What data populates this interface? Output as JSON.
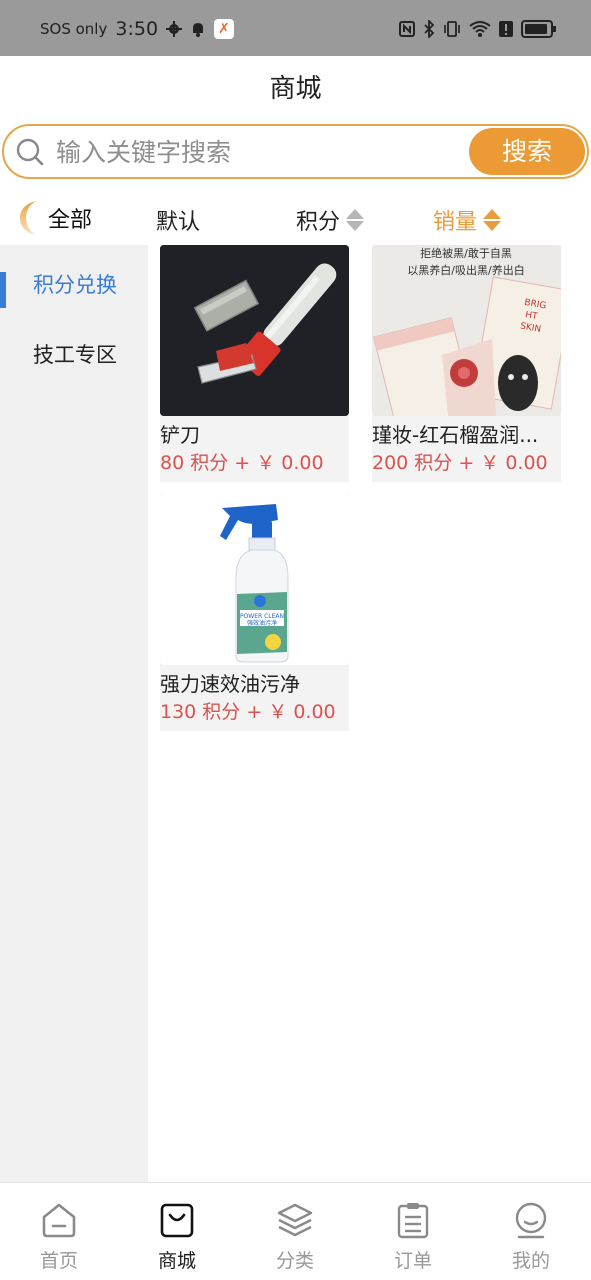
{
  "status_bar": {
    "carrier": "SOS only",
    "time": "3:50",
    "icons": [
      "gear-icon",
      "bell-icon",
      "app-badge-icon",
      "nfc-icon",
      "bluetooth-icon",
      "vibrate-icon",
      "wifi-icon",
      "alert-icon",
      "battery-icon"
    ]
  },
  "header": {
    "title": "商城"
  },
  "search": {
    "placeholder": "输入关键字搜索",
    "button_label": "搜索"
  },
  "sort": {
    "all_label": "全部",
    "default_label": "默认",
    "points_label": "积分",
    "sales_label": "销量",
    "active": "sales",
    "accent_color": "#e99c3c"
  },
  "sidebar": {
    "items": [
      {
        "label": "积分兑换",
        "active": true
      },
      {
        "label": "技工专区",
        "active": false
      }
    ],
    "active_color": "#3a7bd5"
  },
  "products": [
    {
      "name": "铲刀",
      "price": "80 积分 + ￥ 0.00",
      "image": "scraper"
    },
    {
      "name": "瑾妆-红石榴盈润...",
      "price": "200 积分 + ￥ 0.00",
      "image": "face-mask",
      "image_text": [
        "拒绝被黑/敢于自黑",
        "以黑养白/吸出黑/养出白",
        "BRIG",
        "HT",
        "SKIN"
      ]
    },
    {
      "name": "强力速效油污净",
      "price": "130 积分 + ￥ 0.00",
      "image": "spray-bottle",
      "image_text": [
        "POWER CLEAN",
        "强效油污净"
      ]
    }
  ],
  "bottom_nav": {
    "items": [
      {
        "label": "首页",
        "icon": "home-icon",
        "active": false
      },
      {
        "label": "商城",
        "icon": "shopping-bag-icon",
        "active": true
      },
      {
        "label": "分类",
        "icon": "layers-icon",
        "active": false
      },
      {
        "label": "订单",
        "icon": "clipboard-icon",
        "active": false
      },
      {
        "label": "我的",
        "icon": "user-face-icon",
        "active": false
      }
    ]
  }
}
